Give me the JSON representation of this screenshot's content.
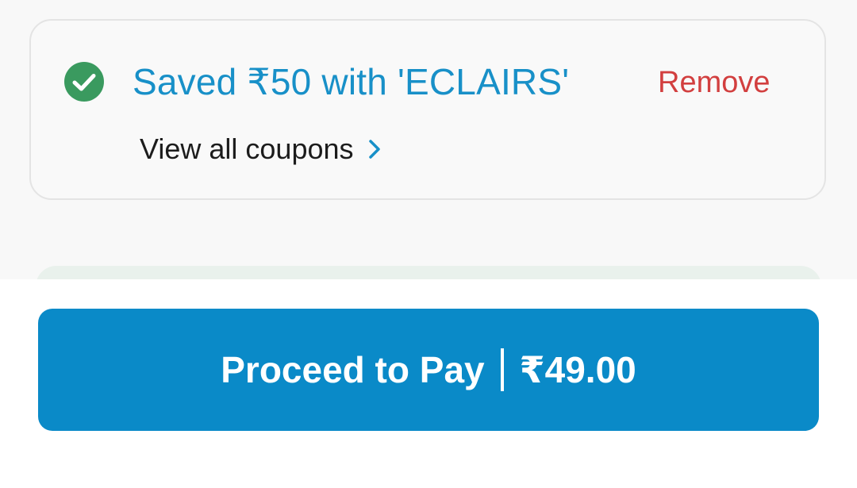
{
  "coupon": {
    "saved_text": "Saved ₹50 with 'ECLAIRS'",
    "remove_label": "Remove",
    "view_all_label": "View all coupons",
    "status_icon": "check-circle-icon",
    "chevron_icon": "chevron-right-icon"
  },
  "checkout": {
    "pay_label": "Proceed to Pay",
    "pay_amount": "₹49.00"
  },
  "colors": {
    "accent_blue": "#0a8ac8",
    "coupon_text_blue": "#1890c8",
    "success_green": "#3a9a5f",
    "remove_red": "#d23f3f"
  }
}
